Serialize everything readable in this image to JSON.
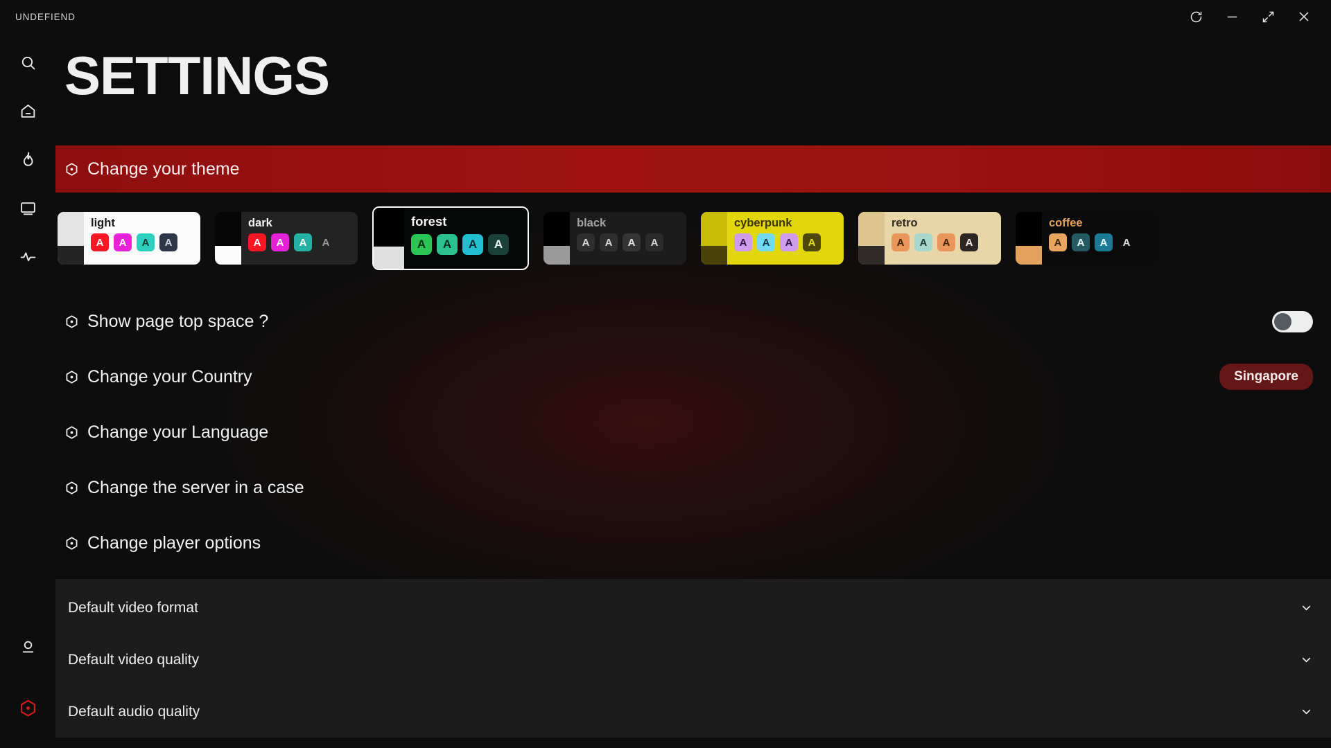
{
  "window": {
    "app_title": "UNDEFIEND",
    "controls": [
      {
        "name": "sync-icon",
        "label": "Sync"
      },
      {
        "name": "minimize-icon",
        "label": "Minimize"
      },
      {
        "name": "maximize-icon",
        "label": "Maximize"
      },
      {
        "name": "close-icon",
        "label": "Close"
      }
    ]
  },
  "sidebar": {
    "top_items": [
      {
        "name": "search-icon",
        "label": "Search"
      },
      {
        "name": "home-icon",
        "label": "Home"
      },
      {
        "name": "flame-icon",
        "label": "Trending"
      },
      {
        "name": "tv-icon",
        "label": "Live TV"
      },
      {
        "name": "activity-icon",
        "label": "Activity"
      }
    ],
    "bottom_items": [
      {
        "name": "user-icon",
        "label": "Profile",
        "active": false
      },
      {
        "name": "settings-hex-icon",
        "label": "Settings",
        "active": true
      }
    ],
    "accent": "#d41b1b"
  },
  "page": {
    "title": "SETTINGS"
  },
  "theme_banner": {
    "label": "Change your theme",
    "bg_from": "#8d0f0f",
    "bg_to": "#8a0d0d"
  },
  "themes": {
    "selected": "forest",
    "items": [
      {
        "name": "light",
        "card_bg": "#fafafa",
        "name_color": "#1b1b1b",
        "strip_top": "#e3e3e3",
        "strip_bottom": "#242424",
        "swatches": [
          {
            "bg": "#fa1622",
            "fg": "#ffffff",
            "letter": "A"
          },
          {
            "bg": "#e621d6",
            "fg": "#ffffff",
            "letter": "A"
          },
          {
            "bg": "#2ecfbe",
            "fg": "#123c38",
            "letter": "A"
          },
          {
            "bg": "#2d3748",
            "fg": "#cbd5e0",
            "letter": "A"
          }
        ]
      },
      {
        "name": "dark",
        "card_bg": "#232323",
        "name_color": "#f4f4f4",
        "strip_top": "#060606",
        "strip_bottom": "#fbfbfb",
        "swatches": [
          {
            "bg": "#fa1622",
            "fg": "#ffffff",
            "letter": "A"
          },
          {
            "bg": "#e621d6",
            "fg": "#ffffff",
            "letter": "A"
          },
          {
            "bg": "#25b2a5",
            "fg": "#ffffff",
            "letter": "A"
          },
          {
            "bg": "transparent",
            "fg": "#9a9a9a",
            "letter": "A"
          }
        ]
      },
      {
        "name": "forest",
        "card_bg": "#050806",
        "name_color": "#f6f6f6",
        "strip_top": "#000000",
        "strip_bottom": "#e0e0e0",
        "swatches": [
          {
            "bg": "#2bc455",
            "fg": "#063417",
            "letter": "A"
          },
          {
            "bg": "#2bc28f",
            "fg": "#06301f",
            "letter": "A"
          },
          {
            "bg": "#22bfd0",
            "fg": "#063038",
            "letter": "A"
          },
          {
            "bg": "#1b4038",
            "fg": "#e6f2ee",
            "letter": "A"
          }
        ]
      },
      {
        "name": "black",
        "card_bg": "#1c1c1c",
        "name_color": "#a2a2a2",
        "strip_top": "#000000",
        "strip_bottom": "#9a9a9a",
        "swatches": [
          {
            "bg": "#2e2e2e",
            "fg": "#d8d8d8",
            "letter": "A"
          },
          {
            "bg": "#2e2e2e",
            "fg": "#d8d8d8",
            "letter": "A"
          },
          {
            "bg": "#343434",
            "fg": "#e4e4e4",
            "letter": "A"
          },
          {
            "bg": "#2a2a2a",
            "fg": "#d2d2d2",
            "letter": "A"
          }
        ]
      },
      {
        "name": "cyberpunk",
        "card_bg": "#e2d60d",
        "name_color": "#3b3506",
        "strip_top": "#c8bd0b",
        "strip_bottom": "#4a4208",
        "swatches": [
          {
            "bg": "#cf9cf0",
            "fg": "#2c1240",
            "letter": "A"
          },
          {
            "bg": "#74d8f5",
            "fg": "#123440",
            "letter": "A"
          },
          {
            "bg": "#cf9cf0",
            "fg": "#2c1240",
            "letter": "A"
          },
          {
            "bg": "#4d4709",
            "fg": "#e7dd2a",
            "letter": "A"
          }
        ]
      },
      {
        "name": "retro",
        "card_bg": "#e8d6a8",
        "name_color": "#2f2a22",
        "strip_top": "#dcc68e",
        "strip_bottom": "#302a28",
        "swatches": [
          {
            "bg": "#e8965a",
            "fg": "#40220c",
            "letter": "A"
          },
          {
            "bg": "#a8d8cb",
            "fg": "#1f3b36",
            "letter": "A"
          },
          {
            "bg": "#e8965a",
            "fg": "#40220c",
            "letter": "A"
          },
          {
            "bg": "#2d2523",
            "fg": "#f3ece2",
            "letter": "A"
          }
        ]
      },
      {
        "name": "coffee",
        "card_bg": "#0b0b0b",
        "name_color": "#e2a15c",
        "strip_top": "#000000",
        "strip_bottom": "#e2a15c",
        "swatches": [
          {
            "bg": "#e7a55f",
            "fg": "#3a2208",
            "letter": "A"
          },
          {
            "bg": "#255a62",
            "fg": "#e8f6f7",
            "letter": "A"
          },
          {
            "bg": "#1d7a96",
            "fg": "#eafafe",
            "letter": "A"
          },
          {
            "bg": "transparent",
            "fg": "#dcdcdc",
            "letter": "A"
          }
        ]
      }
    ]
  },
  "settings_rows": [
    {
      "label": "Show page top space ?",
      "control": "toggle",
      "toggle_on": false
    },
    {
      "label": "Change your Country",
      "control": "pill",
      "pill_value": "Singapore"
    },
    {
      "label": "Change your Language",
      "control": "none"
    },
    {
      "label": "Change the server in a case",
      "control": "none"
    },
    {
      "label": "Change player options",
      "control": "none"
    }
  ],
  "accordion": {
    "rows": [
      {
        "label": "Default video format"
      },
      {
        "label": "Default video quality"
      },
      {
        "label": "Default audio quality"
      }
    ]
  }
}
